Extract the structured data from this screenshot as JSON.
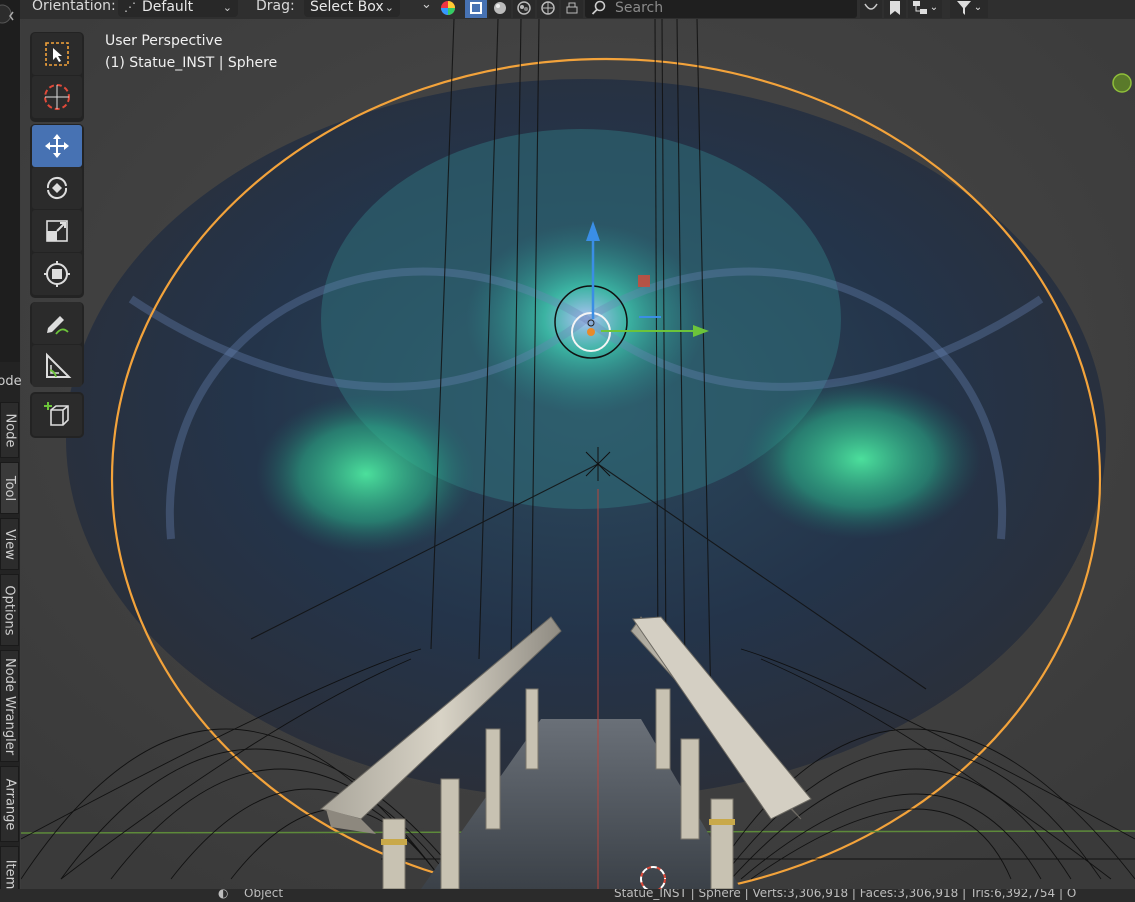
{
  "header": {
    "orientation_label": "Orientation:",
    "orientation_value": "Default",
    "drag_label": "Drag:",
    "drag_value": "Select Box",
    "search_placeholder": "Search"
  },
  "viewport": {
    "view_name": "User Perspective",
    "object_info": "(1) Statue_INST | Sphere"
  },
  "side_tabs": [
    {
      "label": "ode"
    },
    {
      "label": "Node"
    },
    {
      "label": "Tool"
    },
    {
      "label": "View"
    },
    {
      "label": "Options"
    },
    {
      "label": "Node Wrangler"
    },
    {
      "label": "Arrange"
    },
    {
      "label": "Item"
    }
  ],
  "status": {
    "mode": "Object",
    "stats": "Statue_INST | Sphere | Verts:3,306,918 | Faces:3,306,918 | Tris:6,392,754 | O"
  },
  "colors": {
    "accent": "#4772b3",
    "selection": "#f3a33b",
    "header_bg": "#2f2f2f"
  },
  "icons": [
    "select-box-icon",
    "cursor-icon",
    "move-icon",
    "rotate-icon",
    "scale-icon",
    "transform-icon",
    "annotate-icon",
    "measure-icon",
    "add-cube-icon",
    "search-icon",
    "navigation-gizmo-icon"
  ]
}
